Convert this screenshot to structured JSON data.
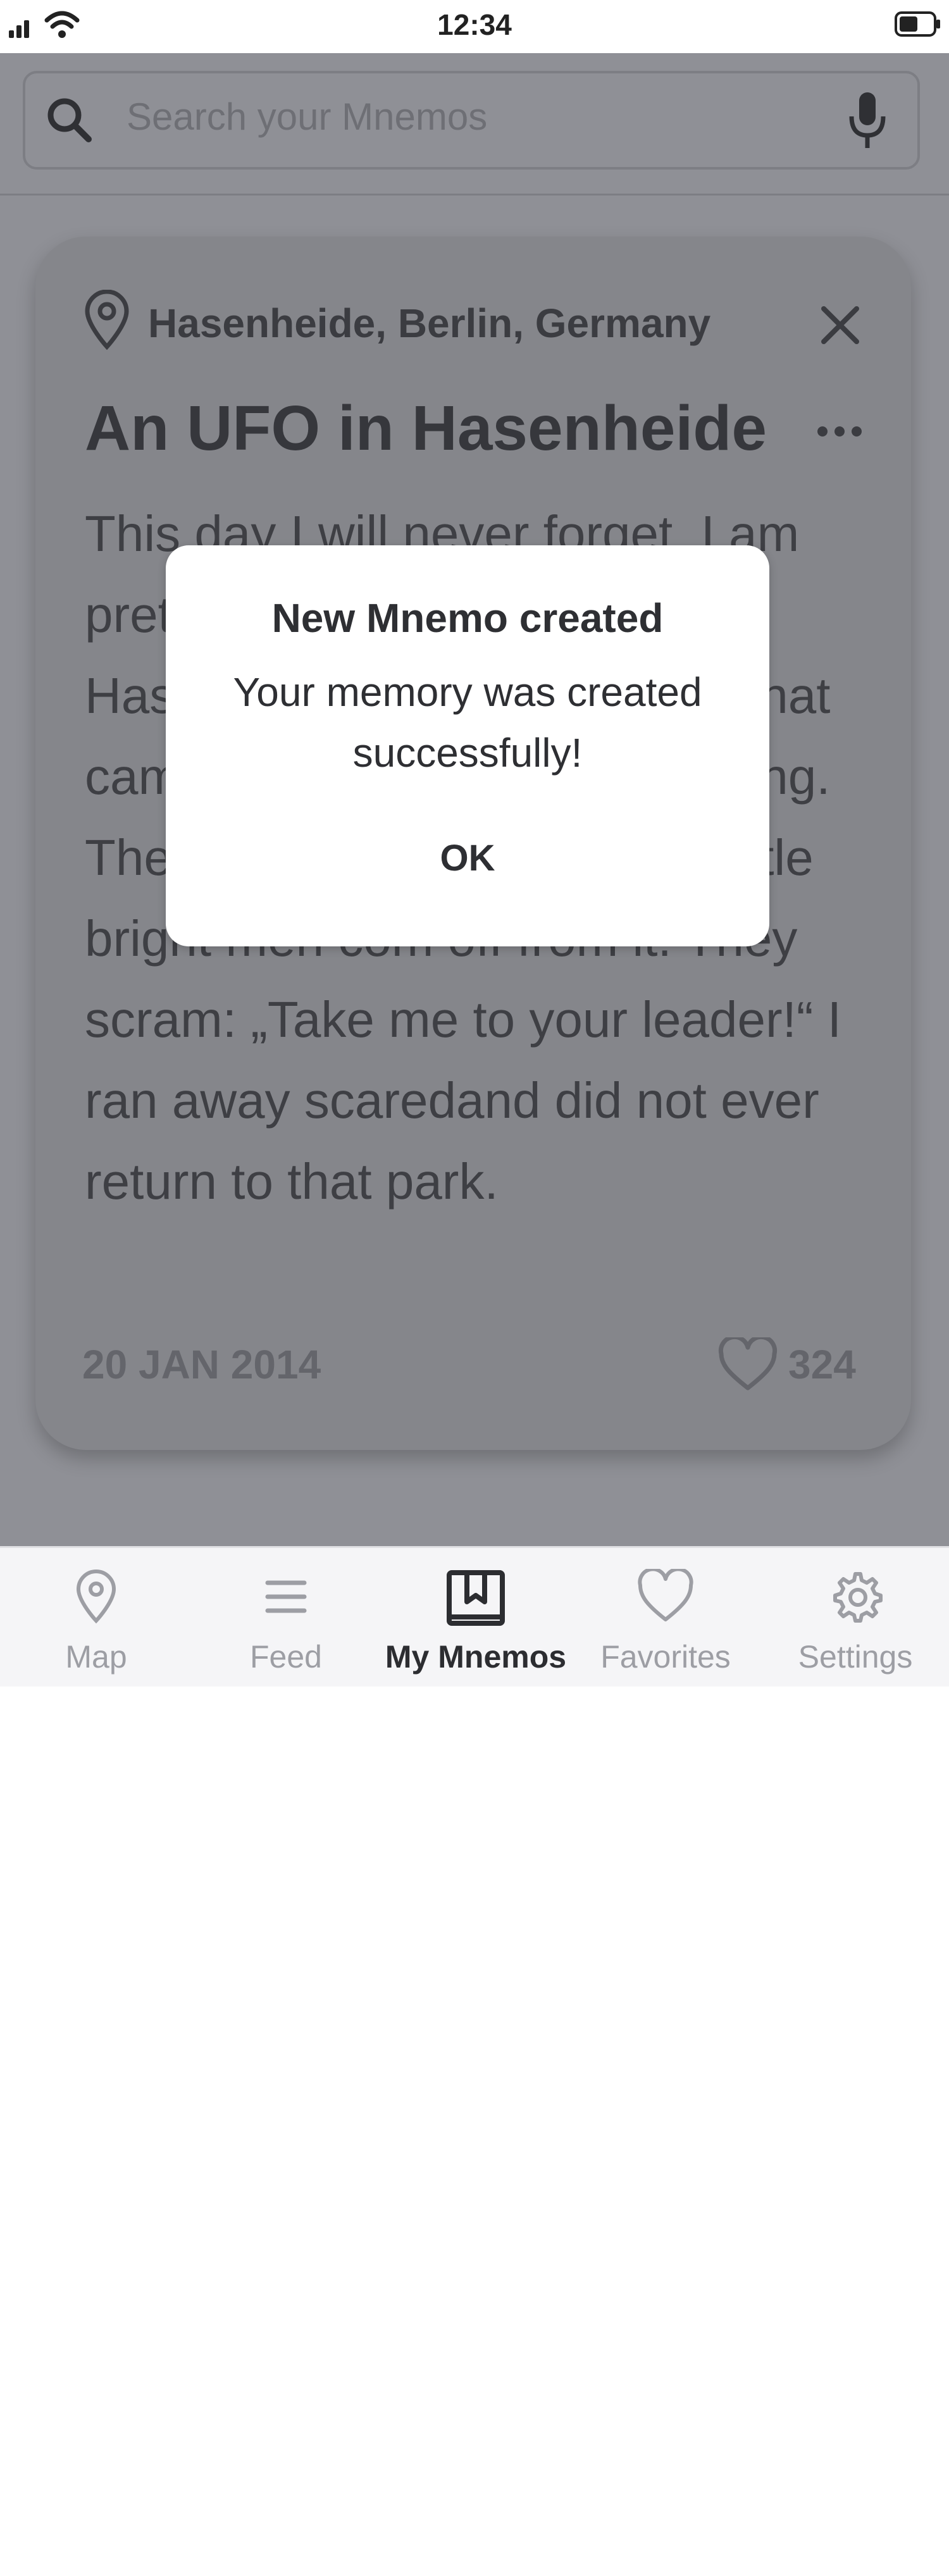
{
  "status_bar": {
    "time": "12:34"
  },
  "search": {
    "placeholder": "Search your Mnemos"
  },
  "card": {
    "location": "Hasenheide, Berlin, Germany",
    "title": "An UFO in Hasenheide",
    "body": "This day I will never forget. I am pretty sure I saw a UFO in Hasenheide. It was a flat ball that came down until it stopped flying. Then they were some funny little bright men com off from it. They scram: „Take me to your leader!“ I ran away scaredand did not ever return to that park.",
    "date": "20 JAN 2014",
    "likes": "324"
  },
  "dialog": {
    "title": "New Mnemo created",
    "message": "Your memory was created successfully!",
    "ok_label": "OK"
  },
  "tabs": [
    {
      "label": "Map",
      "icon": "map-pin-icon",
      "active": false
    },
    {
      "label": "Feed",
      "icon": "feed-icon",
      "active": false
    },
    {
      "label": "My Mnemos",
      "icon": "bookmark-book-icon",
      "active": true
    },
    {
      "label": "Favorites",
      "icon": "heart-icon",
      "active": false
    },
    {
      "label": "Settings",
      "icon": "gear-icon",
      "active": false
    }
  ],
  "colors": {
    "overlay": "#8f9096",
    "card": "#85868b",
    "dialog": "#ffffff",
    "tab_active": "#2c2d31",
    "tab_inactive": "#9d9ea4"
  }
}
